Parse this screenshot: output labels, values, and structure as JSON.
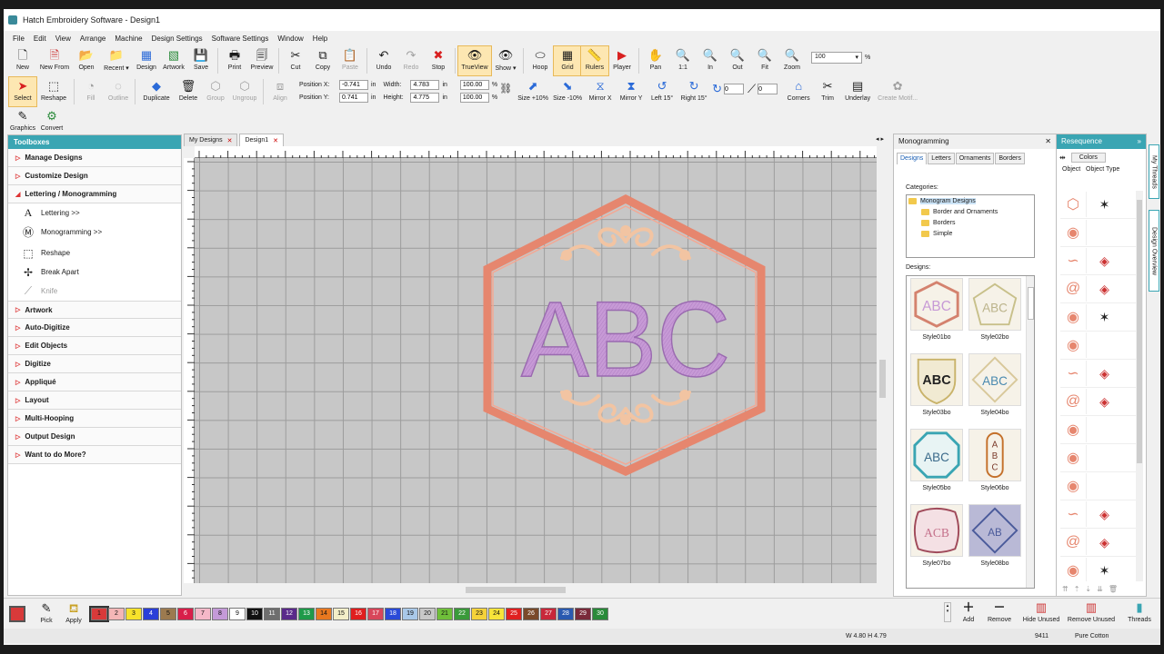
{
  "title": "Hatch Embroidery Software - Design1",
  "menu": [
    "File",
    "Edit",
    "View",
    "Arrange",
    "Machine",
    "Design Settings",
    "Software Settings",
    "Window",
    "Help"
  ],
  "toolbar1": [
    {
      "label": "New",
      "icon": "new-icon"
    },
    {
      "label": "New From",
      "icon": "new-from-icon"
    },
    {
      "label": "Open",
      "icon": "open-icon"
    },
    {
      "label": "Recent ▾",
      "icon": "recent-icon"
    },
    {
      "label": "Design",
      "icon": "design-icon"
    },
    {
      "label": "Artwork",
      "icon": "artwork-icon"
    },
    {
      "label": "Save",
      "icon": "save-icon"
    },
    {
      "label": "Print",
      "icon": "print-icon"
    },
    {
      "label": "Preview",
      "icon": "preview-icon"
    },
    {
      "label": "Cut",
      "icon": "cut-icon"
    },
    {
      "label": "Copy",
      "icon": "copy-icon"
    },
    {
      "label": "Paste",
      "icon": "paste-icon"
    },
    {
      "label": "Undo",
      "icon": "undo-icon"
    },
    {
      "label": "Redo",
      "icon": "redo-icon"
    },
    {
      "label": "Stop",
      "icon": "stop-icon"
    },
    {
      "label": "TrueView",
      "icon": "trueview-icon"
    },
    {
      "label": "Show ▾",
      "icon": "show-icon"
    },
    {
      "label": "Hoop",
      "icon": "hoop-icon"
    },
    {
      "label": "Grid",
      "icon": "grid-icon"
    },
    {
      "label": "Rulers",
      "icon": "rulers-icon"
    },
    {
      "label": "Player",
      "icon": "player-icon"
    },
    {
      "label": "Pan",
      "icon": "pan-icon"
    },
    {
      "label": "1:1",
      "icon": "actual-size-icon"
    },
    {
      "label": "In",
      "icon": "zoom-in-icon"
    },
    {
      "label": "Out",
      "icon": "zoom-out-icon"
    },
    {
      "label": "Fit",
      "icon": "zoom-fit-icon"
    },
    {
      "label": "Zoom",
      "icon": "zoom-icon"
    }
  ],
  "zoom": {
    "value": "100",
    "unit": "%"
  },
  "toolbar2": [
    {
      "label": "Select",
      "icon": "select-arrow-icon"
    },
    {
      "label": "Reshape",
      "icon": "reshape-icon"
    },
    {
      "label": "Fill",
      "icon": "fill-icon"
    },
    {
      "label": "Outline",
      "icon": "outline-icon"
    },
    {
      "label": "Duplicate",
      "icon": "duplicate-icon"
    },
    {
      "label": "Delete",
      "icon": "delete-icon"
    },
    {
      "label": "Group",
      "icon": "group-icon"
    },
    {
      "label": "Ungroup",
      "icon": "ungroup-icon"
    },
    {
      "label": "Align",
      "icon": "align-icon"
    }
  ],
  "position": {
    "x_label": "Position X:",
    "x": "-0.741",
    "y_label": "Position Y:",
    "y": "0.741",
    "unit": "in"
  },
  "size": {
    "w_label": "Width:",
    "w": "4.783",
    "h_label": "Height:",
    "h": "4.775",
    "unit": "in",
    "pw": "100.00",
    "ph": "100.00",
    "pct": "%"
  },
  "toolbar3": [
    {
      "label": "Size +10%"
    },
    {
      "label": "Size -10%"
    },
    {
      "label": "Mirror X"
    },
    {
      "label": "Mirror Y"
    },
    {
      "label": "Left 15°"
    },
    {
      "label": "Right 15°"
    }
  ],
  "rotate": {
    "a": "0",
    "b": "0"
  },
  "toolbar4": [
    {
      "label": "Corners"
    },
    {
      "label": "Trim"
    },
    {
      "label": "Underlay"
    },
    {
      "label": "Create Motif..."
    }
  ],
  "toolbar5": [
    {
      "label": "Graphics"
    },
    {
      "label": "Convert"
    }
  ],
  "toolboxes": {
    "header": "Toolboxes",
    "sections": [
      "Manage Designs",
      "Customize Design",
      "Lettering / Monogramming"
    ],
    "subitems": [
      {
        "label": "Lettering >>",
        "icon": "lettering-icon"
      },
      {
        "label": "Monogramming >>",
        "icon": "monogram-icon"
      },
      {
        "label": "Reshape",
        "icon": "reshape-icon"
      },
      {
        "label": "Break Apart",
        "icon": "break-apart-icon"
      },
      {
        "label": "Knife",
        "icon": "knife-icon"
      }
    ],
    "more": [
      "Artwork",
      "Auto-Digitize",
      "Edit Objects",
      "Digitize",
      "Appliqué",
      "Layout",
      "Multi-Hooping",
      "Output Design",
      "Want to do More?"
    ]
  },
  "tabs": [
    {
      "label": "My Designs"
    },
    {
      "label": "Design1"
    }
  ],
  "monogram_text": "ABC",
  "mono_panel": {
    "title": "Monogramming",
    "tabs": [
      "Designs",
      "Letters",
      "Ornaments",
      "Borders"
    ],
    "categories_label": "Categories:",
    "categories": [
      "Monogram Designs",
      "Border and Ornaments",
      "Borders",
      "Simple"
    ],
    "designs_label": "Designs:",
    "designs": [
      "Style01bo",
      "Style02bo",
      "Style03bo",
      "Style04bo",
      "Style05bo",
      "Style06bo",
      "Style07bo",
      "Style08bo"
    ]
  },
  "reseq": {
    "title": "Resequence",
    "colors_btn": "Colors",
    "col_object": "Object",
    "col_type": "Object Type"
  },
  "right_tabs": [
    "My Threads",
    "Design Overview"
  ],
  "palette": {
    "pick": "Pick",
    "apply": "Apply",
    "swatches": [
      {
        "n": "1",
        "c": "#d83a3a"
      },
      {
        "n": "2",
        "c": "#f4b6b6"
      },
      {
        "n": "3",
        "c": "#f7e22b"
      },
      {
        "n": "4",
        "c": "#2a3ed8"
      },
      {
        "n": "5",
        "c": "#9c7a4f"
      },
      {
        "n": "6",
        "c": "#d81f4a"
      },
      {
        "n": "7",
        "c": "#f5b8c8"
      },
      {
        "n": "8",
        "c": "#c49ad8"
      },
      {
        "n": "9",
        "c": "#ffffff"
      },
      {
        "n": "10",
        "c": "#111111"
      },
      {
        "n": "11",
        "c": "#6e6e6e"
      },
      {
        "n": "12",
        "c": "#5a2a8a"
      },
      {
        "n": "13",
        "c": "#1f9a4a"
      },
      {
        "n": "14",
        "c": "#e8781f"
      },
      {
        "n": "15",
        "c": "#f3eec8"
      },
      {
        "n": "16",
        "c": "#e01e1e"
      },
      {
        "n": "17",
        "c": "#d8465a"
      },
      {
        "n": "18",
        "c": "#2a4ad8"
      },
      {
        "n": "19",
        "c": "#a9c8e8"
      },
      {
        "n": "20",
        "c": "#c8c8c8"
      },
      {
        "n": "21",
        "c": "#6fbf3a"
      },
      {
        "n": "22",
        "c": "#3a9a3a"
      },
      {
        "n": "23",
        "c": "#f5d23a"
      },
      {
        "n": "24",
        "c": "#f7e43a"
      },
      {
        "n": "25",
        "c": "#e02020"
      },
      {
        "n": "26",
        "c": "#7a4a2a"
      },
      {
        "n": "27",
        "c": "#c8283a"
      },
      {
        "n": "28",
        "c": "#2a5ab0"
      },
      {
        "n": "29",
        "c": "#7a2a3a"
      },
      {
        "n": "30",
        "c": "#2a8a3a"
      }
    ],
    "add": "Add",
    "remove": "Remove",
    "hide_unused": "Hide Unused",
    "remove_unused": "Remove Unused",
    "threads": "Threads"
  },
  "status": {
    "dims": "W 4.80 H 4.79",
    "code": "9411",
    "thread": "Pure Cotton"
  },
  "colors": {
    "teal": "#3aa5b3",
    "salmon": "#e6866e",
    "peach": "#f2c4a2",
    "lilac": "#c79ad6",
    "highlight": "#fde7b2"
  }
}
